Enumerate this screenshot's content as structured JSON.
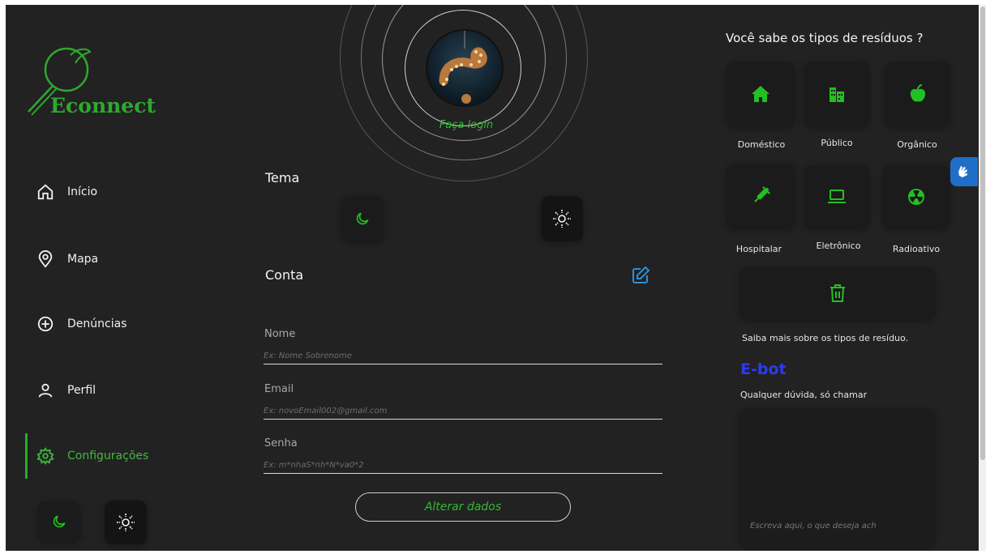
{
  "brand": {
    "name": "Econnect",
    "accent": "#2fa82f"
  },
  "nav": {
    "items": [
      {
        "label": "Início",
        "icon": "home-icon"
      },
      {
        "label": "Mapa",
        "icon": "map-pin-icon"
      },
      {
        "label": "Denúncias",
        "icon": "plus-circle-icon"
      },
      {
        "label": "Perfil",
        "icon": "user-icon"
      },
      {
        "label": "Configurações",
        "icon": "gear-icon",
        "active": true
      }
    ],
    "theme_toggle": [
      "moon-icon",
      "sun-icon"
    ]
  },
  "profile": {
    "login_link": "Faça login"
  },
  "theme": {
    "title": "Tema",
    "options": [
      "moon-icon",
      "sun-icon"
    ]
  },
  "account": {
    "title": "Conta",
    "fields": [
      {
        "label": "Nome",
        "placeholder": "Ex: Nome Sobrenome"
      },
      {
        "label": "Email",
        "placeholder": "Ex: novoEmail002@gmail.com"
      },
      {
        "label": "Senha",
        "placeholder": "Ex: m*nhaS*nh*N*va0*2"
      }
    ],
    "submit": "Alterar dados"
  },
  "waste": {
    "title": "Você sabe os tipos de resíduos ?",
    "types": [
      {
        "label": "Doméstico",
        "icon": "house-icon"
      },
      {
        "label": "Público",
        "icon": "buildings-icon"
      },
      {
        "label": "Orgânico",
        "icon": "apple-icon"
      },
      {
        "label": "Hospitalar",
        "icon": "syringe-icon"
      },
      {
        "label": "Eletrônico",
        "icon": "laptop-icon"
      },
      {
        "label": "Radioativo",
        "icon": "radiation-icon"
      }
    ],
    "more_icon": "trash-icon",
    "more_text": "Saiba mais sobre os tipos de resíduo."
  },
  "ebot": {
    "title": "E-bot",
    "subtitle": "Qualquer dúvida, só chamar",
    "placeholder": "Escreva aqui, o que deseja ach"
  },
  "colors": {
    "green": "#22c022",
    "edit_blue": "#2f8fd6",
    "ebot_blue": "#2b3bf0"
  }
}
